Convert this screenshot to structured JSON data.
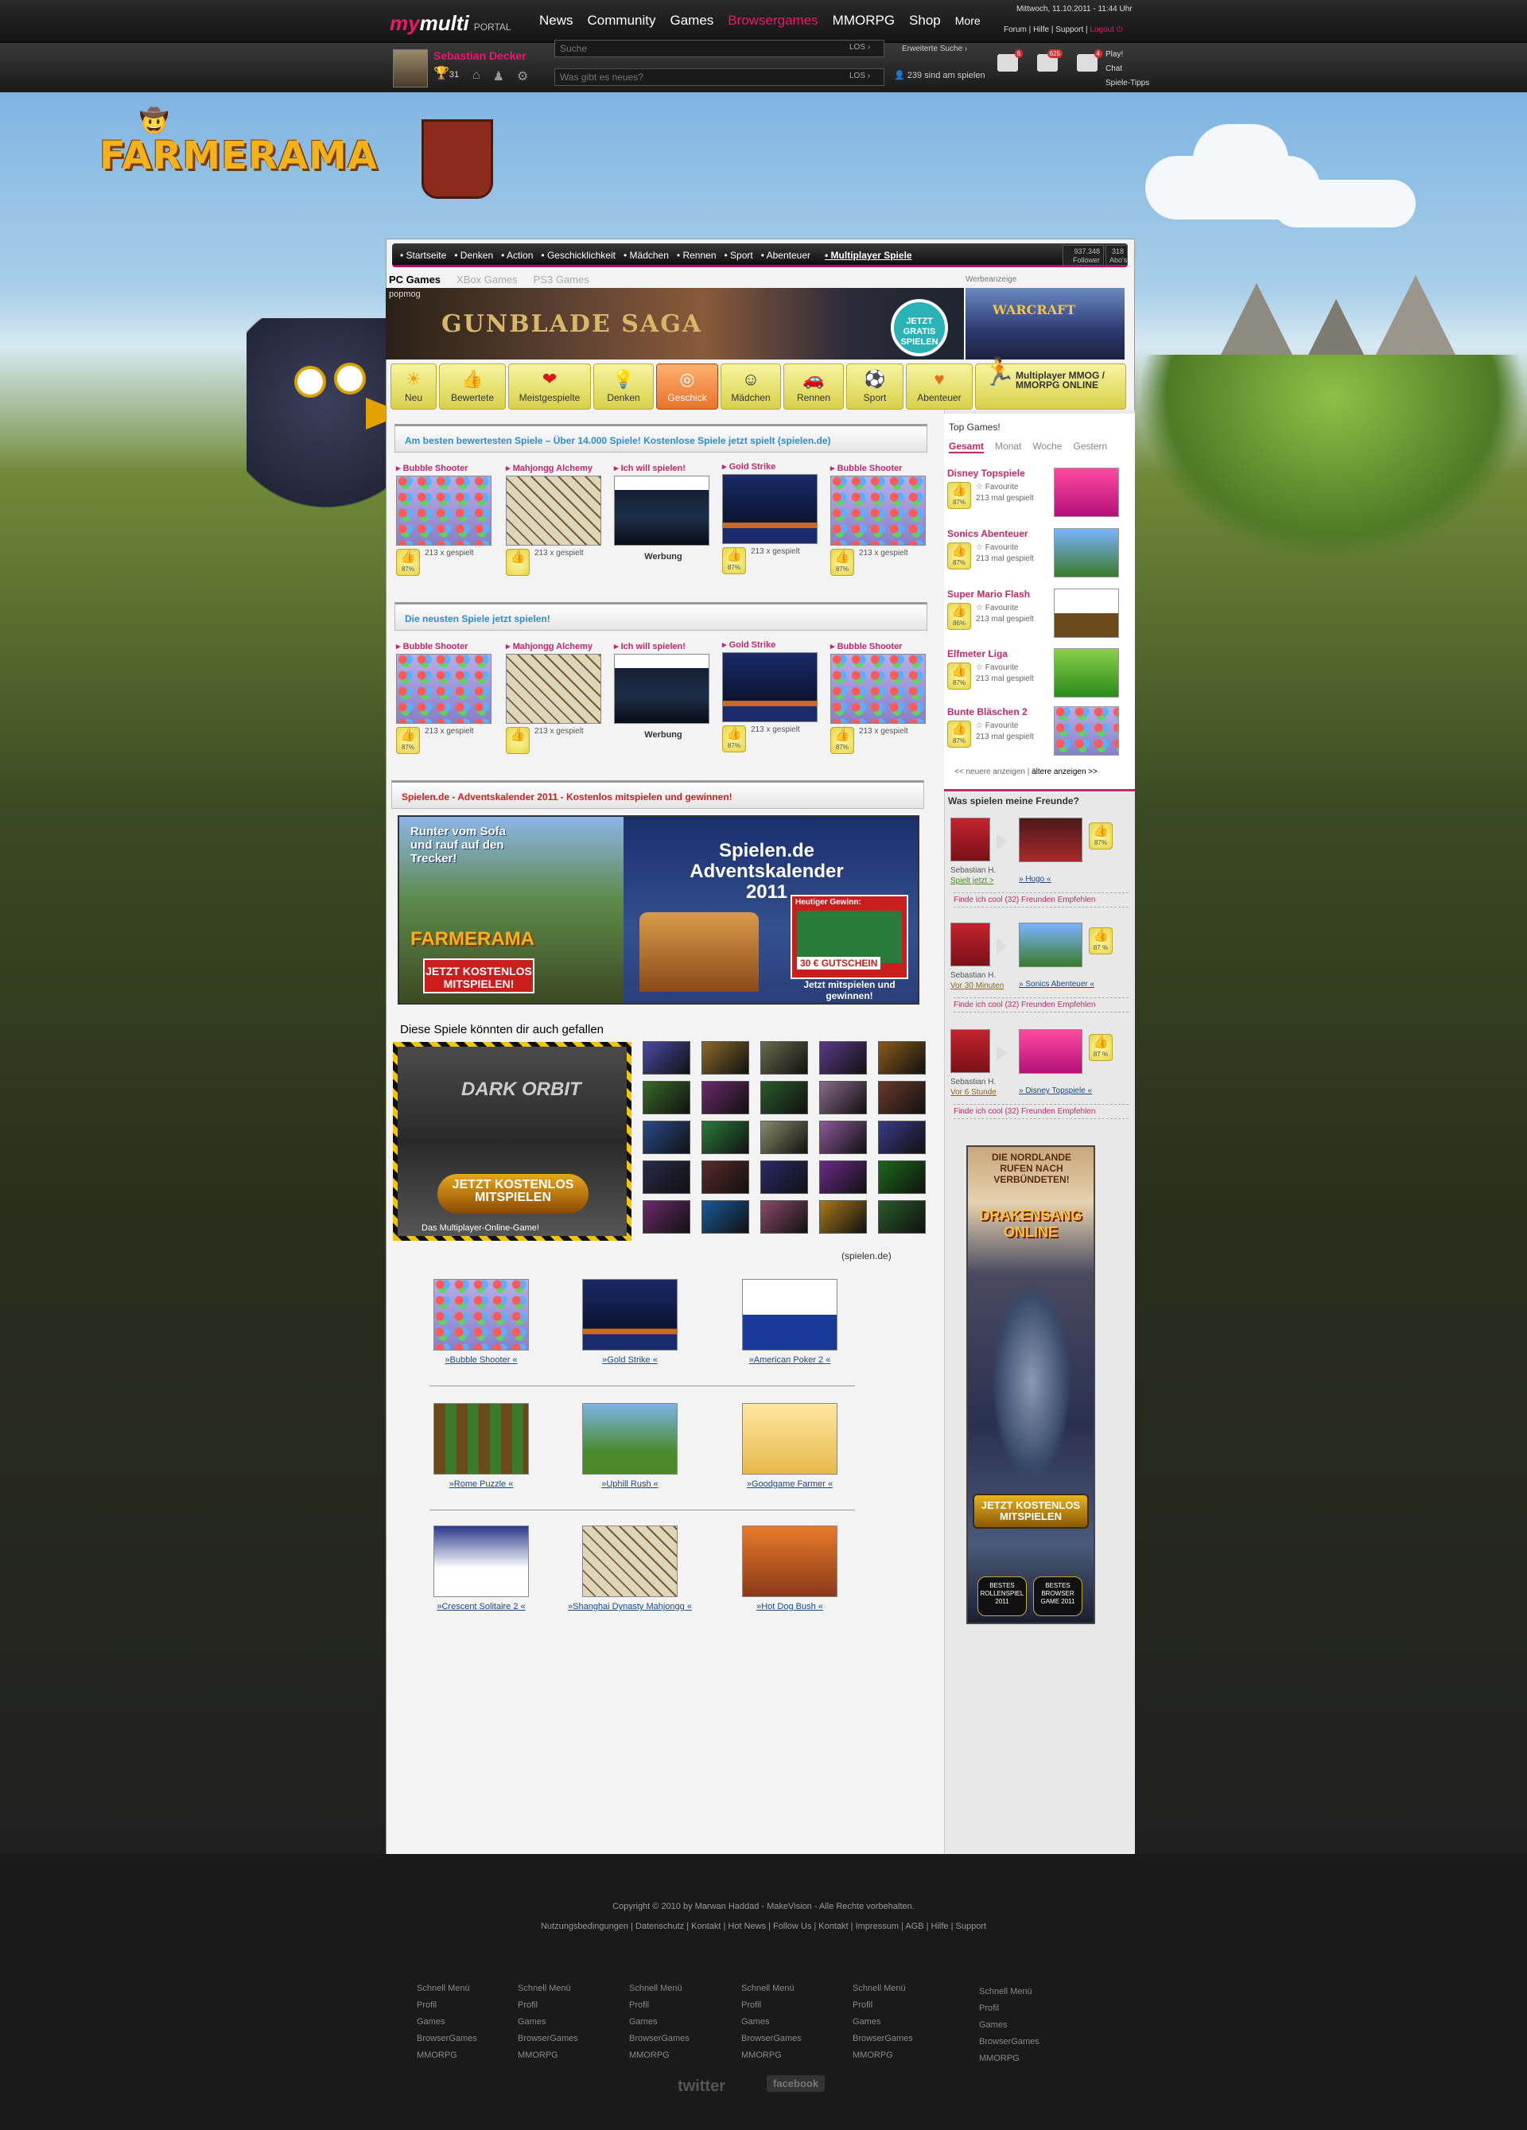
{
  "topbar": {
    "logo_my": "my",
    "logo_multi": "multi",
    "logo_portal": "PORTAL",
    "nav": [
      "News",
      "Community",
      "Games",
      "Browsergames",
      "MMORPG",
      "Shop",
      "More"
    ],
    "nav_active": "Browsergames",
    "date": "Mittwoch, 11.10.2011 - 11:44 Uhr",
    "links": [
      "Forum",
      "Hilfe",
      "Support"
    ],
    "logout": "Logout"
  },
  "user": {
    "name": "Sebastian Decker",
    "trophies": "31",
    "search_placeholder": "Suche",
    "status_placeholder": "Was gibt es neues?",
    "los": "LOS",
    "erweiterte_suche": "Erweiterte Suche",
    "online": "239 sind am spielen",
    "notif_counts": [
      "6",
      "625",
      "4"
    ],
    "play_links": [
      "Play!",
      "Chat",
      "Spiele-Tipps"
    ]
  },
  "brand": {
    "logo": "FARMERAMA"
  },
  "catnav": {
    "items": [
      "Startseite",
      "Denken",
      "Action",
      "Geschicklichkeit",
      "Mädchen",
      "Rennen",
      "Sport",
      "Abenteuer"
    ],
    "multiplayer": "Multiplayer Spiele",
    "followers_num": "937.348",
    "followers_label": "Follower",
    "abos_num": "318",
    "abos_label": "Abo's"
  },
  "platform": {
    "tabs": [
      "PC Games",
      "XBox Games",
      "PS3 Games"
    ],
    "active": "PC Games",
    "werbe": "Werbeanzeige"
  },
  "banner": {
    "popmog": "popmog",
    "gunblade": "GUNBLADE SAGA",
    "gratis": "JETZT GRATIS SPIELEN",
    "warcraft": "WARCRAFT"
  },
  "categories": [
    {
      "label": "Neu",
      "icon": "sun-icon",
      "glyph": "☀"
    },
    {
      "label": "Bewertete",
      "icon": "thumbsup-icon",
      "glyph": "👍"
    },
    {
      "label": "Meistgespielte",
      "icon": "heart-icon",
      "glyph": "❤"
    },
    {
      "label": "Denken",
      "icon": "bulb-icon",
      "glyph": "💡"
    },
    {
      "label": "Geschick",
      "icon": "target-icon",
      "glyph": "◎"
    },
    {
      "label": "Mädchen",
      "icon": "girl-icon",
      "glyph": "☺"
    },
    {
      "label": "Rennen",
      "icon": "car-icon",
      "glyph": "🚗"
    },
    {
      "label": "Sport",
      "icon": "ball-icon",
      "glyph": "⚽"
    },
    {
      "label": "Abenteuer",
      "icon": "heartbeat-icon",
      "glyph": "♥"
    }
  ],
  "cat_active": "Geschick",
  "cat_mp": "Multiplayer MMOG / MMORPG ONLINE",
  "section1": {
    "title": "Am besten bewertesten Spiele – Über 14.000 Spiele! Kostenlose Spiele jetzt spielt (spielen.de)",
    "games": [
      {
        "title": "Bubble Shooter",
        "plays": "213 x gespielt",
        "rating": "87%",
        "type": "bub"
      },
      {
        "title": "Mahjongg Alchemy",
        "plays": "213 x gespielt",
        "rating": "",
        "type": "mah"
      },
      {
        "title": "Ich will spielen!",
        "plays": "Werbung",
        "rating": "",
        "type": "ich"
      },
      {
        "title": "Gold Strike",
        "plays": "213 x gespielt",
        "rating": "87%",
        "type": "gold"
      },
      {
        "title": "Bubble Shooter",
        "plays": "213 x gespielt",
        "rating": "87%",
        "type": "bub"
      }
    ]
  },
  "section2": {
    "title": "Die neusten Spiele jetzt spielen!"
  },
  "section3": {
    "title": "Spielen.de - Adventskalender 2011 - Kostenlos mitspielen und gewinnen!"
  },
  "advent": {
    "left_text": "Runter vom Sofa und rauf auf den Trecker!",
    "left_logo": "FARMERAMA",
    "left_btn": "JETZT KOSTENLOS MITSPIELEN!",
    "right_title": "Spielen.de Adventskalender 2011",
    "gewinn": "Heutiger Gewinn:",
    "gutschein": "30 € GUTSCHEIN",
    "mitspielen": "Jetzt mitspielen und gewinnen!"
  },
  "recommend": {
    "title": "Diese Spiele könnten dir auch gefallen",
    "dark_title": "DARK ORBIT",
    "dark_btn": "JETZT KOSTENLOS MITSPIELEN",
    "dark_foot": "Das Multiplayer-Online-Game!",
    "source": "(spielen.de)",
    "mini_colors": [
      "#4a4aa8",
      "#8a6a2a",
      "#6a6a4a",
      "#5a3a8a",
      "#8a5a1a",
      "#3a6a2a",
      "#6a2a6a",
      "#2a5a2a",
      "#8a6a8a",
      "#6a3a2a",
      "#2a4a8a",
      "#2a7a3a",
      "#8a8a6a",
      "#8a5a9a",
      "#3a3a8a",
      "#2a2a4a",
      "#5a2a2a",
      "#2a2a6a",
      "#6a2a8a",
      "#1a6a1a",
      "#6a2a6a",
      "#1a5a9a",
      "#8a4a6a",
      "#aa7a1a",
      "#2a5a2a"
    ]
  },
  "related": [
    {
      "label": "»Bubble Shooter «",
      "type": "bub"
    },
    {
      "label": "»Gold Strike «",
      "type": "gold"
    },
    {
      "label": "»American Poker 2 «",
      "type": "poker"
    },
    {
      "label": "»Rome Puzzle «",
      "type": "rome"
    },
    {
      "label": "»Uphill Rush «",
      "type": "uphill"
    },
    {
      "label": "»Goodgame Farmer «",
      "type": "farmer"
    },
    {
      "label": "»Crescent Solitaire 2 «",
      "type": "cresc"
    },
    {
      "label": "»Shanghai Dynasty Mahjongg «",
      "type": "mah"
    },
    {
      "label": "»Hot Dog Bush «",
      "type": "hotdog"
    }
  ],
  "top_games": {
    "title": "Top Games!",
    "tabs": [
      "Gesamt",
      "Monat",
      "Woche",
      "Gestern"
    ],
    "active": "Gesamt",
    "items": [
      {
        "name": "Disney Topspiele",
        "fav": "Favourite",
        "plays": "213 mal gespielt",
        "rating": "87%"
      },
      {
        "name": "Sonics Abenteuer",
        "fav": "Favourite",
        "plays": "213 mal gespielt",
        "rating": "87%"
      },
      {
        "name": "Super Mario Flash",
        "fav": "Favourite",
        "plays": "213 mal gespielt",
        "rating": "86%"
      },
      {
        "name": "Elfmeter Liga",
        "fav": "Favourite",
        "plays": "213 mal gespielt",
        "rating": "87%"
      },
      {
        "name": "Bunte Bläschen 2",
        "fav": "Favourite",
        "plays": "213 mal gespielt",
        "rating": "87%"
      }
    ],
    "newer": "<< neuere anzeigen",
    "older": "ältere anzeigen >>"
  },
  "friends": {
    "title": "Was spielen meine Freunde?",
    "items": [
      {
        "name": "Sebastian H.",
        "when": "Spielt jetzt >",
        "game": "» Hugo «",
        "rating": "87%",
        "actions": "Finde ich cool (32)   Freunden Empfehlen"
      },
      {
        "name": "Sebastian H.",
        "when": "Vor 30 Minuten",
        "game": "» Sonics Abenteuer «",
        "rating": "87 %",
        "actions": "Finde ich cool (32)   Freunden Empfehlen"
      },
      {
        "name": "Sebastian H.",
        "when": "Vor 6 Stunde",
        "game": "» Disney Topspiele «",
        "rating": "87 %",
        "actions": "Finde ich cool (32)   Freunden Empfehlen"
      }
    ]
  },
  "drakensang": {
    "head": "DIE NORDLANDE RUFEN NACH VERBÜNDETEN!",
    "logo": "DRAKENSANG ONLINE",
    "btn": "JETZT KOSTENLOS MITSPIELEN",
    "badge1": "BESTES ROLLENSPIEL 2011",
    "badge2": "BESTES BROWSER GAME 2011"
  },
  "footer": {
    "copy": "Copyright © 2010 by Marwan Haddad - MakeVision - Alle Rechte vorbehalten.",
    "links": "Nutzungsbedingungen | Datenschutz | Kontakt | Hot News | Follow Us | Kontakt | Impressum | AGB | Hilfe | Support",
    "cols": [
      [
        "Schnell Menü",
        "Profil",
        "Games",
        "BrowserGames",
        "MMORPG"
      ],
      [
        "Schnell Menü",
        "Profil",
        "Games",
        "BrowserGames",
        "MMORPG"
      ],
      [
        "Schnell Menü",
        "Profil",
        "Games",
        "BrowserGames",
        "MMORPG"
      ],
      [
        "Schnell Menü",
        "Profil",
        "Games",
        "BrowserGames",
        "MMORPG"
      ],
      [
        "Schnell Menü",
        "Profil",
        "Games",
        "BrowserGames",
        "MMORPG"
      ],
      [
        "Schnell Menü",
        "Profil",
        "Games",
        "BrowserGames",
        "MMORPG"
      ]
    ],
    "twitter": "twitter",
    "facebook": "facebook"
  }
}
